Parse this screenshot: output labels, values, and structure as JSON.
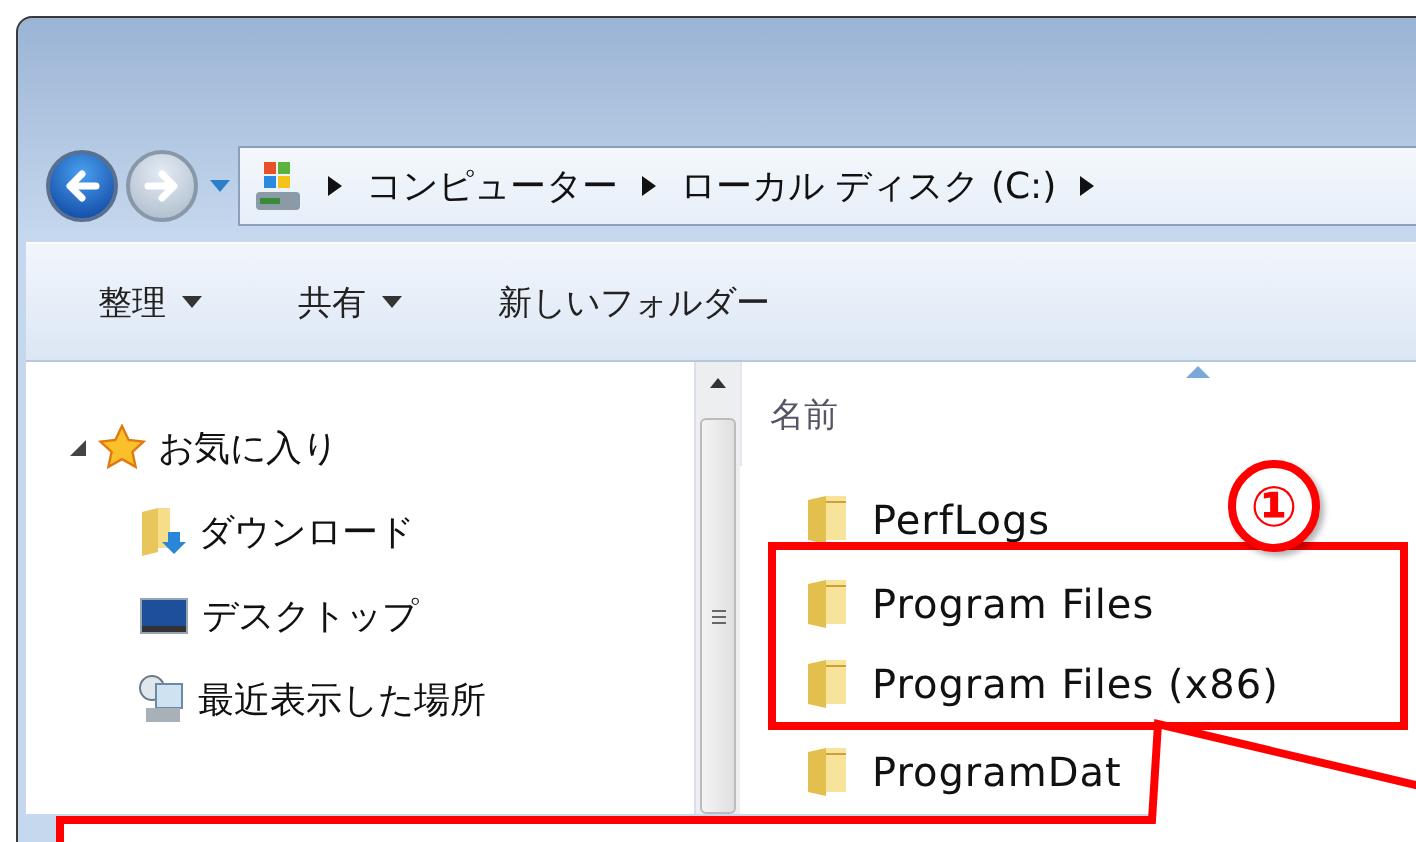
{
  "navigation": {
    "back_enabled": true,
    "forward_enabled": false,
    "breadcrumb": [
      "コンピューター",
      "ローカル ディスク (C:)"
    ]
  },
  "toolbar": [
    {
      "label": "整理",
      "dropdown": true
    },
    {
      "label": "共有",
      "dropdown": true
    },
    {
      "label": "新しいフォルダー",
      "dropdown": false
    }
  ],
  "sidebar": {
    "items": [
      {
        "label": "お気に入り",
        "kind": "favorites",
        "expanded": true,
        "children": [
          {
            "label": "ダウンロード",
            "kind": "downloads"
          },
          {
            "label": "デスクトップ",
            "kind": "desktop"
          },
          {
            "label": "最近表示した場所",
            "kind": "recent"
          }
        ]
      }
    ]
  },
  "file_list": {
    "column": "名前",
    "rows": [
      {
        "name": "PerfLogs",
        "highlighted": false
      },
      {
        "name": "Program Files",
        "highlighted": true
      },
      {
        "name": "Program Files (x86)",
        "highlighted": true
      },
      {
        "name": "ProgramDat",
        "highlighted": false
      }
    ]
  },
  "annotation": {
    "number": "①"
  }
}
